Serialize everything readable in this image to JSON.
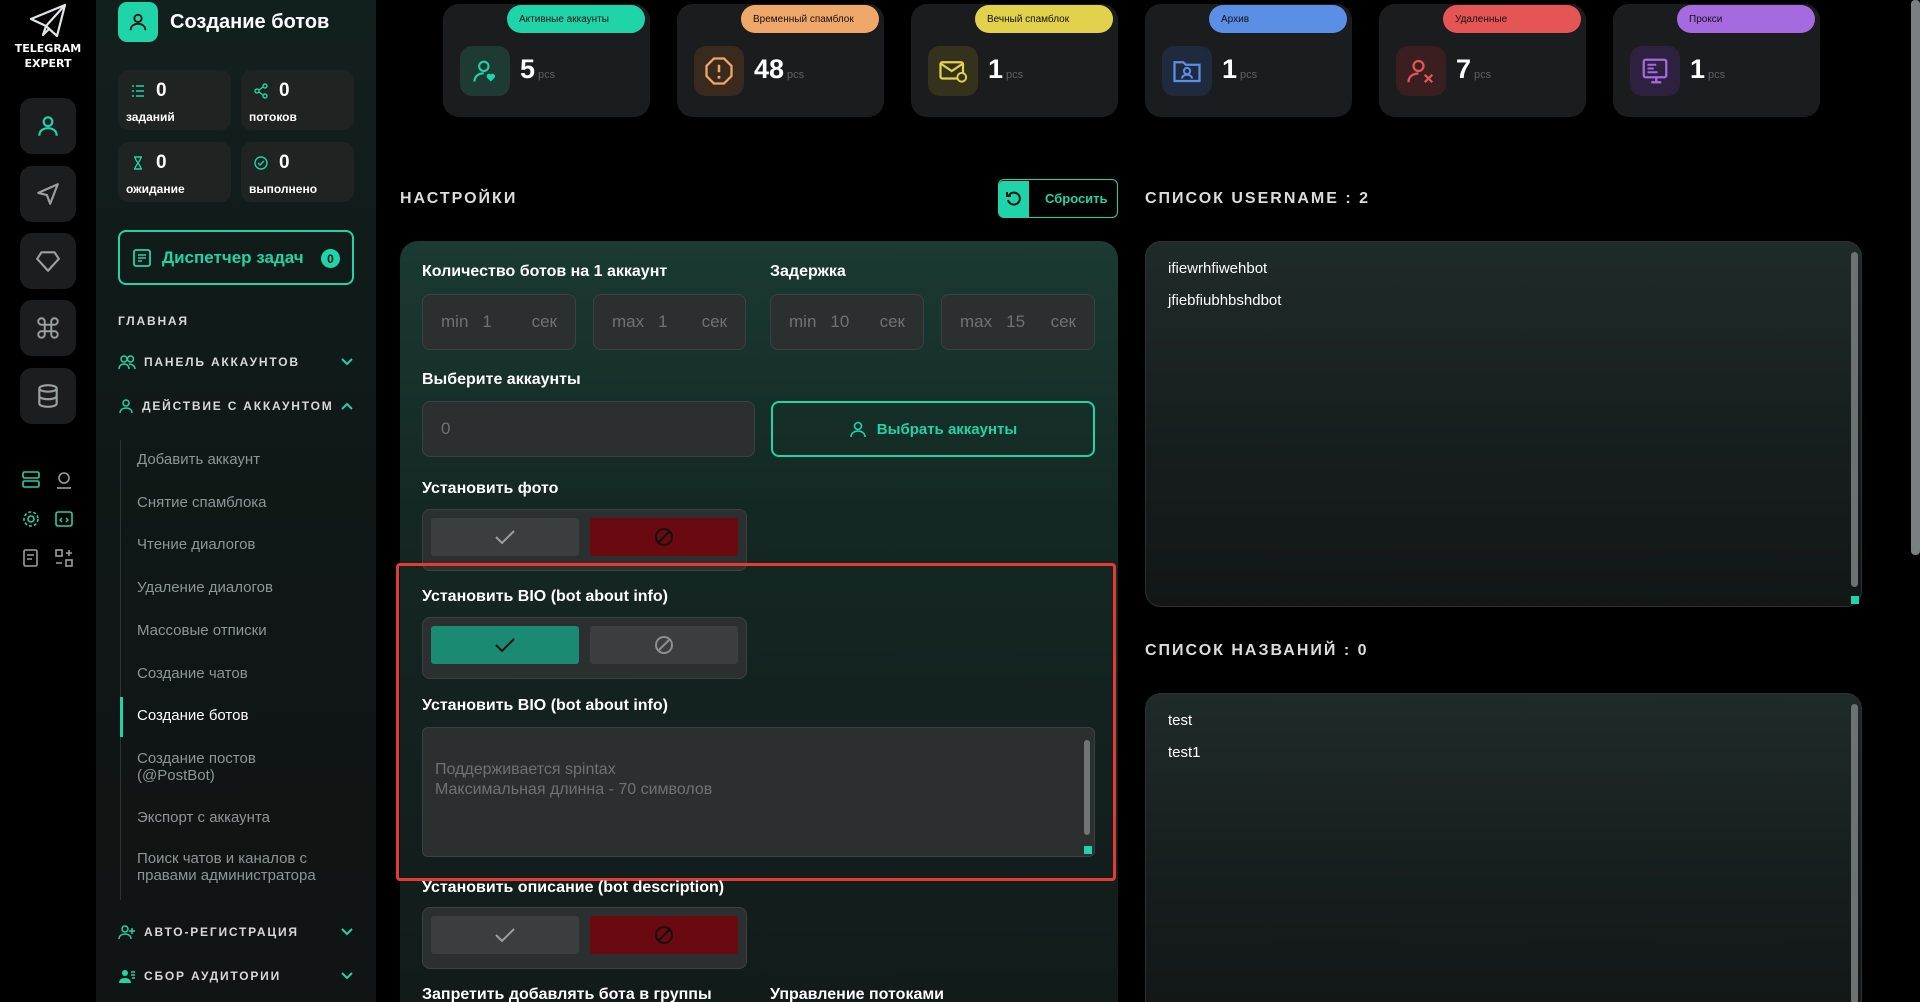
{
  "app": {
    "name_line1": "TELEGRAM",
    "name_line2": "EXPERT"
  },
  "sidebar": {
    "title": "Создание ботов",
    "stats": [
      {
        "value": "0",
        "label": "заданий"
      },
      {
        "value": "0",
        "label": "потоков"
      },
      {
        "value": "0",
        "label": "ожидание"
      },
      {
        "value": "0",
        "label": "выполнено"
      }
    ],
    "dispatcher": {
      "label": "Диспетчер задач",
      "count": "0"
    },
    "section_main": "ГЛАВНАЯ",
    "menu": {
      "accounts_panel": "ПАНЕЛЬ АККАУНТОВ",
      "account_actions": "ДЕЙСТВИЕ С АККАУНТОМ",
      "auto_reg": "АВТО-РЕГИСТРАЦИЯ",
      "audience": "СБОР АУДИТОРИИ"
    },
    "submenu": [
      "Добавить аккаунт",
      "Снятие спамблока",
      "Чтение диалогов",
      "Удаление диалогов",
      "Массовые отписки",
      "Создание чатов",
      "Создание ботов",
      "Создание постов (@PostBot)",
      "Экспорт с аккаунта",
      "Поиск чатов и каналов с правами администратора"
    ],
    "active_submenu": "Создание ботов"
  },
  "cards": [
    {
      "label": "Активные аккаунты",
      "value": "5",
      "unit": "pcs",
      "color": "#1ed4a8"
    },
    {
      "label": "Временный спамблок",
      "value": "48",
      "unit": "pcs",
      "color": "#f0a86a"
    },
    {
      "label": "Вечный спамблок",
      "value": "1",
      "unit": "pcs",
      "color": "#e2d24b"
    },
    {
      "label": "Архив",
      "value": "1",
      "unit": "pcs",
      "color": "#5b8fe6"
    },
    {
      "label": "Удаленные",
      "value": "7",
      "unit": "pcs",
      "color": "#e55555"
    },
    {
      "label": "Прокси",
      "value": "1",
      "unit": "pcs",
      "color": "#a56ae0"
    }
  ],
  "settings": {
    "heading": "НАСТРОЙКИ",
    "reset_label": "Сбросить",
    "bots_per_account_label": "Количество ботов на 1 аккаунт",
    "delay_label": "Задержка",
    "min_prefix": "min",
    "max_prefix": "max",
    "unit": "сек",
    "bots_min": "1",
    "bots_max": "1",
    "delay_min": "10",
    "delay_max": "15",
    "choose_accounts_label": "Выберите аккаунты",
    "accounts_count": "0",
    "choose_accounts_button": "Выбрать аккаунты",
    "set_photo_label": "Установить фото",
    "set_bio_label": "Установить BIO (bot about info)",
    "bio_text_label": "Установить BIO (bot about info)",
    "bio_placeholder": "Поддерживается spintax\nМаксимальная длинна - 70 символов",
    "set_description_label": "Установить описание (bot description)",
    "forbid_groups_label": "Запретить добавлять бота в группы",
    "threads_label": "Управление потоками"
  },
  "usernames": {
    "heading": "СПИСОК USERNAME : 2",
    "items": [
      "ifiewrhfiwehbot",
      "jfiebfiubhbshdbot"
    ]
  },
  "names": {
    "heading": "СПИСОК НАЗВАНИЙ : 0",
    "items": [
      "test",
      "test1"
    ]
  }
}
